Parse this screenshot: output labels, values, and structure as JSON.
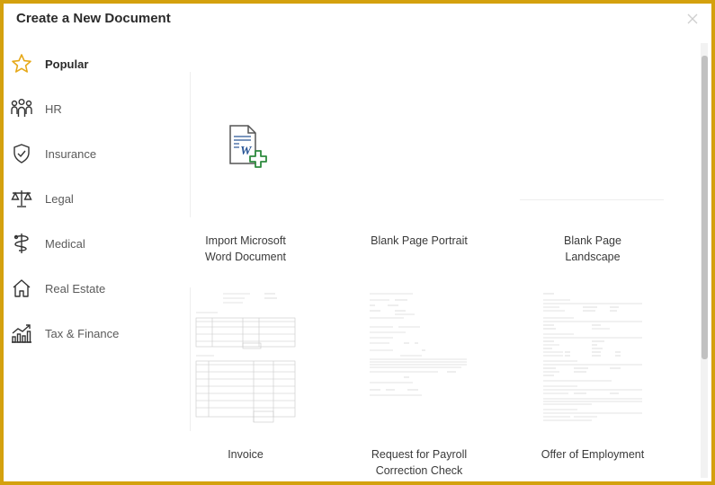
{
  "dialog": {
    "title": "Create a New Document",
    "close_icon": "close-icon"
  },
  "sidebar": {
    "items": [
      {
        "label": "Popular",
        "icon": "star-icon",
        "active": true
      },
      {
        "label": "HR",
        "icon": "people-icon",
        "active": false
      },
      {
        "label": "Insurance",
        "icon": "shield-check-icon",
        "active": false
      },
      {
        "label": "Legal",
        "icon": "scales-icon",
        "active": false
      },
      {
        "label": "Medical",
        "icon": "caduceus-icon",
        "active": false
      },
      {
        "label": "Real Estate",
        "icon": "house-icon",
        "active": false
      },
      {
        "label": "Tax & Finance",
        "icon": "chart-growth-icon",
        "active": false
      }
    ]
  },
  "templates": [
    {
      "line1": "Import Microsoft",
      "line2": "Word Document"
    },
    {
      "line1": "Blank Page Portrait",
      "line2": ""
    },
    {
      "line1": "Blank Page",
      "line2": "Landscape"
    },
    {
      "line1": "Invoice",
      "line2": ""
    },
    {
      "line1": "Request for Payroll",
      "line2": "Correction Check"
    },
    {
      "line1": "Offer of Employment",
      "line2": ""
    }
  ],
  "colors": {
    "border": "#d4a10e",
    "star": "#e6a817",
    "word_blue": "#2b5797",
    "plus_green": "#2e8b3e"
  }
}
